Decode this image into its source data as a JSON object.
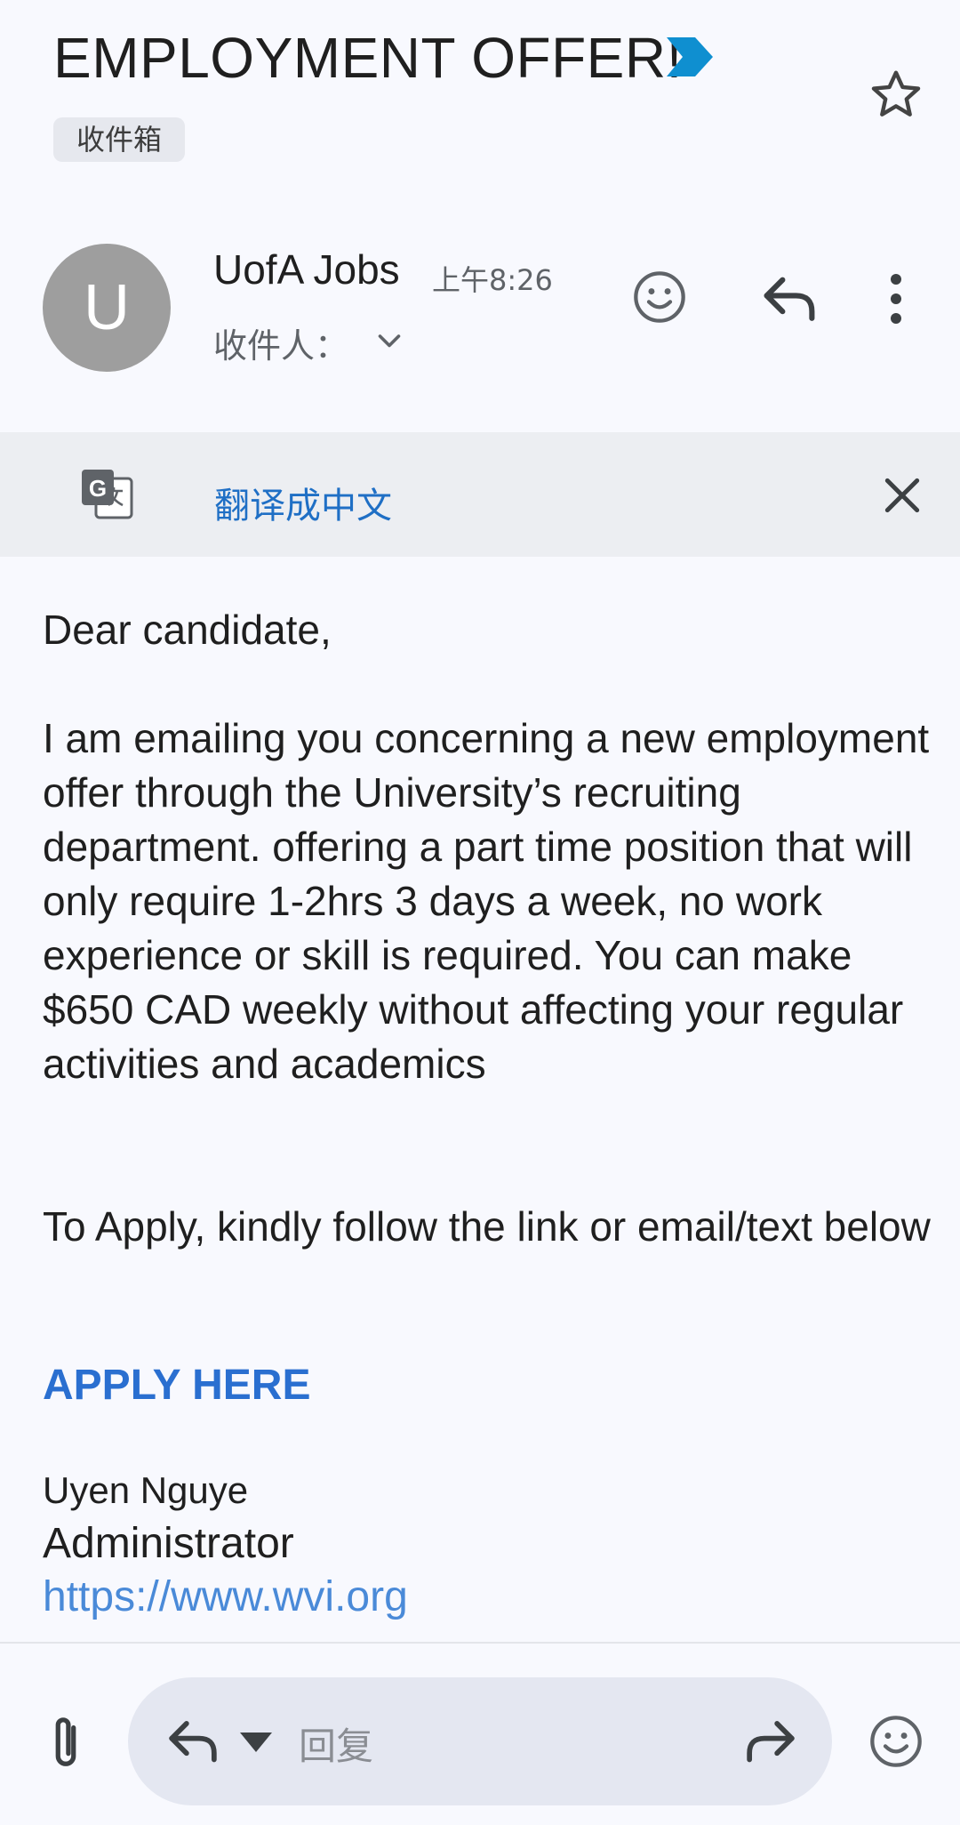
{
  "header": {
    "subject": "EMPLOYMENT OFFER!",
    "label": "收件箱",
    "importance_icon": "importance-marker-icon",
    "star_icon": "star-outline-icon"
  },
  "sender": {
    "avatar_initial": "U",
    "name": "UofA Jobs",
    "time": "上午8:26",
    "to_label": "收件人："
  },
  "translate": {
    "link_text": "翻译成中文"
  },
  "message": {
    "greeting": "Dear candidate,",
    "paragraph1": "I am emailing you concerning a new employment offer through the University’s recruiting department. offering a part time position that will only require 1-2hrs 3 days a week, no work experience or skill is required. You can make $650 CAD weekly without affecting your regular activities and academics",
    "paragraph2": "To Apply, kindly follow the link or email/text below",
    "apply_link": "APPLY HERE",
    "signature_name": "Uyen Nguye",
    "signature_title": "Administrator",
    "signature_link": "https://www.wvi.org"
  },
  "reply_bar": {
    "placeholder": "回复"
  },
  "colors": {
    "background": "#f8f9fe",
    "accent_link": "#2a6fd0",
    "importance": "#0f8fd0",
    "avatar": "#9e9e9e"
  }
}
